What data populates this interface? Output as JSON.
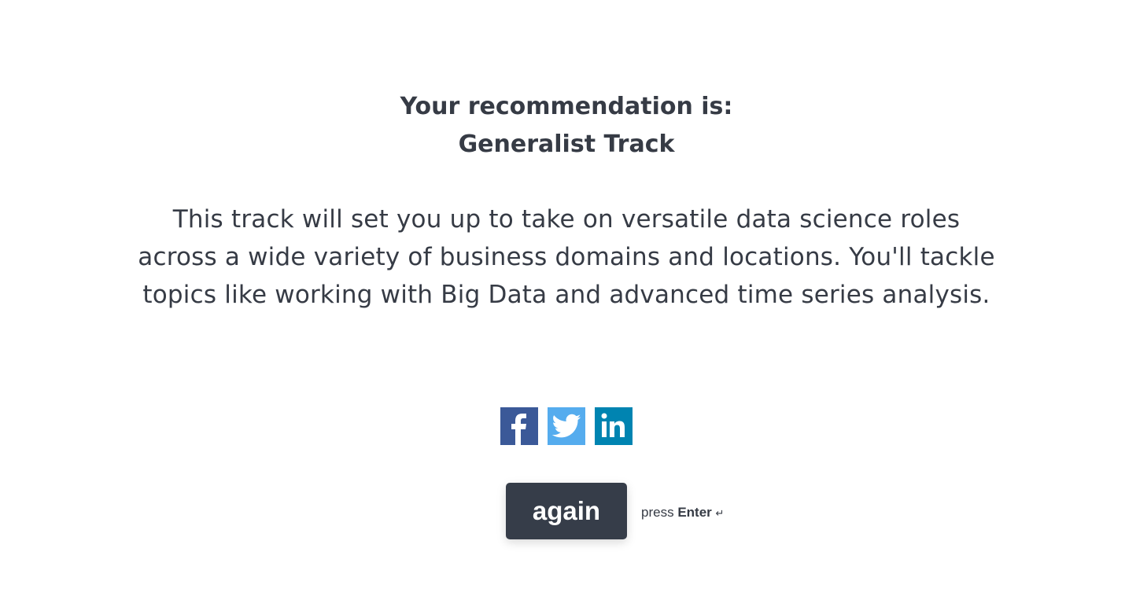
{
  "result": {
    "heading": "Your recommendation is:",
    "track": "Generalist Track"
  },
  "description": "This track will set you up to take on versatile data science roles across a wide variety of business domains and locations. You'll tackle topics like working with Big Data and advanced time series analysis.",
  "social": [
    {
      "name": "facebook-icon",
      "color": "#3b5998"
    },
    {
      "name": "twitter-icon",
      "color": "#55acee"
    },
    {
      "name": "linkedin-icon",
      "color": "#0084b1"
    }
  ],
  "button": {
    "label": "again"
  },
  "hint": {
    "prefix": "press",
    "key": "Enter",
    "symbol": "↵"
  }
}
